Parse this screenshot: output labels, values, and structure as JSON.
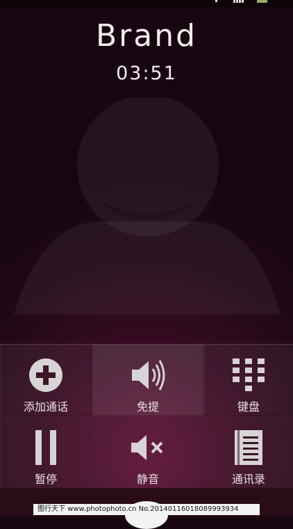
{
  "call": {
    "caller_name": "Brand",
    "duration": "03:51"
  },
  "controls": [
    {
      "label": "添加通话",
      "icon": "add-call-icon"
    },
    {
      "label": "免提",
      "icon": "speaker-icon"
    },
    {
      "label": "键盘",
      "icon": "dialpad-icon"
    },
    {
      "label": "暂停",
      "icon": "pause-icon"
    },
    {
      "label": "静音",
      "icon": "mute-icon"
    },
    {
      "label": "通讯录",
      "icon": "contacts-icon"
    }
  ],
  "watermark": {
    "text": "图行天下 www.photophoto.cn  No.20140116018089993934"
  },
  "colors": {
    "background": "#1f0815",
    "accent": "#5c0f33"
  }
}
